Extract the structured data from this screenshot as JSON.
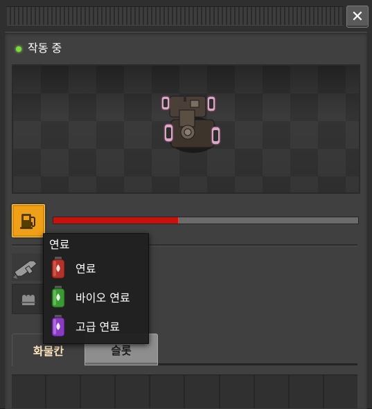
{
  "window": {
    "close_icon_glyph": "✕"
  },
  "status": {
    "text": "작동 중",
    "color": "#7bdd3a"
  },
  "fuel": {
    "slot_icon": "fuel-pump-icon",
    "burn_progress": 0.41,
    "burn_color": "#c8100c",
    "slot_color": "#f0a017"
  },
  "equipment": {
    "weapon_icon": "machine-gun-icon",
    "ammo_icon": "ammo-icon"
  },
  "tabs": [
    {
      "label": "화물칸",
      "active": true
    },
    {
      "label": "슬롯",
      "active": false
    }
  ],
  "inventory": {
    "visible_cells": 10
  },
  "tooltip": {
    "title": "연료",
    "items": [
      {
        "label": "연료",
        "icon": "chemical-fuel-icon",
        "color": "#c0392b"
      },
      {
        "label": "바이오 연료",
        "icon": "bio-fuel-icon",
        "color": "#3aa335"
      },
      {
        "label": "고급 연료",
        "icon": "advanced-fuel-icon",
        "color": "#8e3fc4"
      }
    ]
  }
}
